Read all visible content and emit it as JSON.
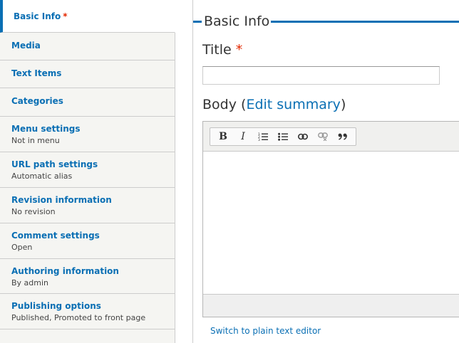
{
  "vertical_tabs": [
    {
      "title": "Basic Info",
      "summary": "",
      "required": "*",
      "active": true
    },
    {
      "title": "Media",
      "summary": ""
    },
    {
      "title": "Text Items",
      "summary": ""
    },
    {
      "title": "Categories",
      "summary": ""
    },
    {
      "title": "Menu settings",
      "summary": "Not in menu"
    },
    {
      "title": "URL path settings",
      "summary": "Automatic alias"
    },
    {
      "title": "Revision information",
      "summary": "No revision"
    },
    {
      "title": "Comment settings",
      "summary": "Open"
    },
    {
      "title": "Authoring information",
      "summary": "By admin"
    },
    {
      "title": "Publishing options",
      "summary": "Published, Promoted to front page"
    }
  ],
  "fieldset": {
    "legend": "Basic Info"
  },
  "title_field": {
    "label": "Title",
    "required": "*",
    "value": ""
  },
  "body_field": {
    "label": "Body",
    "open_paren": "(",
    "edit_summary_link": "Edit summary",
    "close_paren": ")"
  },
  "toolbar": {
    "bold_label": "B",
    "italic_label": "I",
    "icons": [
      "bold-icon",
      "italic-icon",
      "numbered-list-icon",
      "bulleted-list-icon",
      "link-icon",
      "unlink-icon",
      "blockquote-icon"
    ]
  },
  "switch_editor_link": "Switch to plain text editor",
  "colors": {
    "link_blue": "#0a6fb4",
    "required_red": "#e32700",
    "tab_background": "#f5f5f2"
  }
}
